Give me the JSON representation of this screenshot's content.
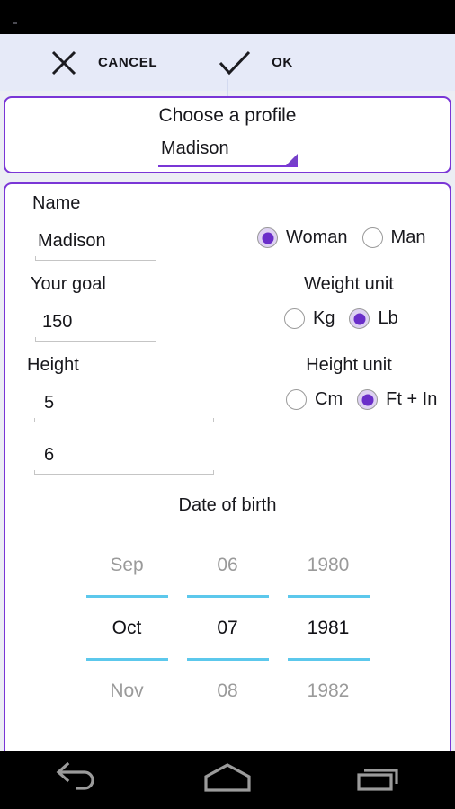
{
  "action_bar": {
    "cancel_label": "CANCEL",
    "ok_label": "OK",
    "cancel_icon": "close-x-icon",
    "ok_icon": "check-icon"
  },
  "profile": {
    "title": "Choose a profile",
    "selected": "Madison",
    "dropdown_icon": "dropdown-triangle-icon"
  },
  "form": {
    "name_label": "Name",
    "name_value": "Madison",
    "goal_label": "Your goal",
    "goal_value": "150",
    "height_label": "Height",
    "height_feet_value": "5",
    "height_inches_value": "6",
    "gender": {
      "options": [
        "Woman",
        "Man"
      ],
      "selected": "Woman"
    },
    "weight_unit": {
      "title": "Weight unit",
      "options": [
        "Kg",
        "Lb"
      ],
      "selected": "Lb"
    },
    "height_unit": {
      "title": "Height unit",
      "options": [
        "Cm",
        "Ft + In"
      ],
      "selected": "Ft + In"
    }
  },
  "date_of_birth": {
    "title": "Date of birth",
    "month": {
      "prev": "Sep",
      "selected": "Oct",
      "next": "Nov"
    },
    "day": {
      "prev": "06",
      "selected": "07",
      "next": "08"
    },
    "year": {
      "prev": "1980",
      "selected": "1981",
      "next": "1982"
    }
  },
  "nav_bar": {
    "back_icon": "back-arrow-icon",
    "home_icon": "home-icon",
    "recents_icon": "recents-icon"
  },
  "colors": {
    "accent_purple": "#7a36d6",
    "radio_fill": "#6a2ec9",
    "picker_separator": "#5cc8ec",
    "action_bar_bg": "#e6eaf8"
  }
}
